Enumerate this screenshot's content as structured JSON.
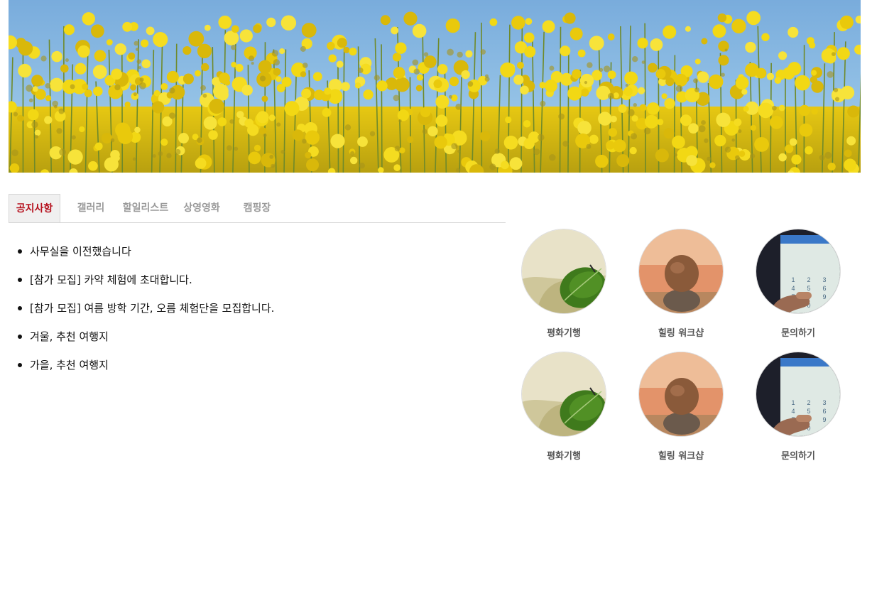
{
  "banner": {
    "icon": "canola-flower-field-image"
  },
  "tabs": [
    {
      "label": "공지사항",
      "active": true
    },
    {
      "label": "갤러리",
      "active": false
    },
    {
      "label": "할일리스트",
      "active": false
    },
    {
      "label": "상영영화",
      "active": false
    },
    {
      "label": "캠핑장",
      "active": false
    }
  ],
  "notices": [
    "사무실을 이전했습니다",
    "[참가 모집] 카약 체험에 초대합니다.",
    "[참가 모집] 여름 방학 기간, 오름 체험단을 모집합니다.",
    "겨울, 추천 여행지",
    "가을, 추천 여행지"
  ],
  "menu": [
    {
      "label": "평화기행",
      "icon": "leaf-on-sand-image"
    },
    {
      "label": "힐링 워크샵",
      "icon": "balanced-stones-image"
    },
    {
      "label": "문의하기",
      "icon": "phone-dialpad-image"
    },
    {
      "label": "평화기행",
      "icon": "leaf-on-sand-image"
    },
    {
      "label": "힐링 워크샵",
      "icon": "balanced-stones-image"
    },
    {
      "label": "문의하기",
      "icon": "phone-dialpad-image"
    }
  ]
}
